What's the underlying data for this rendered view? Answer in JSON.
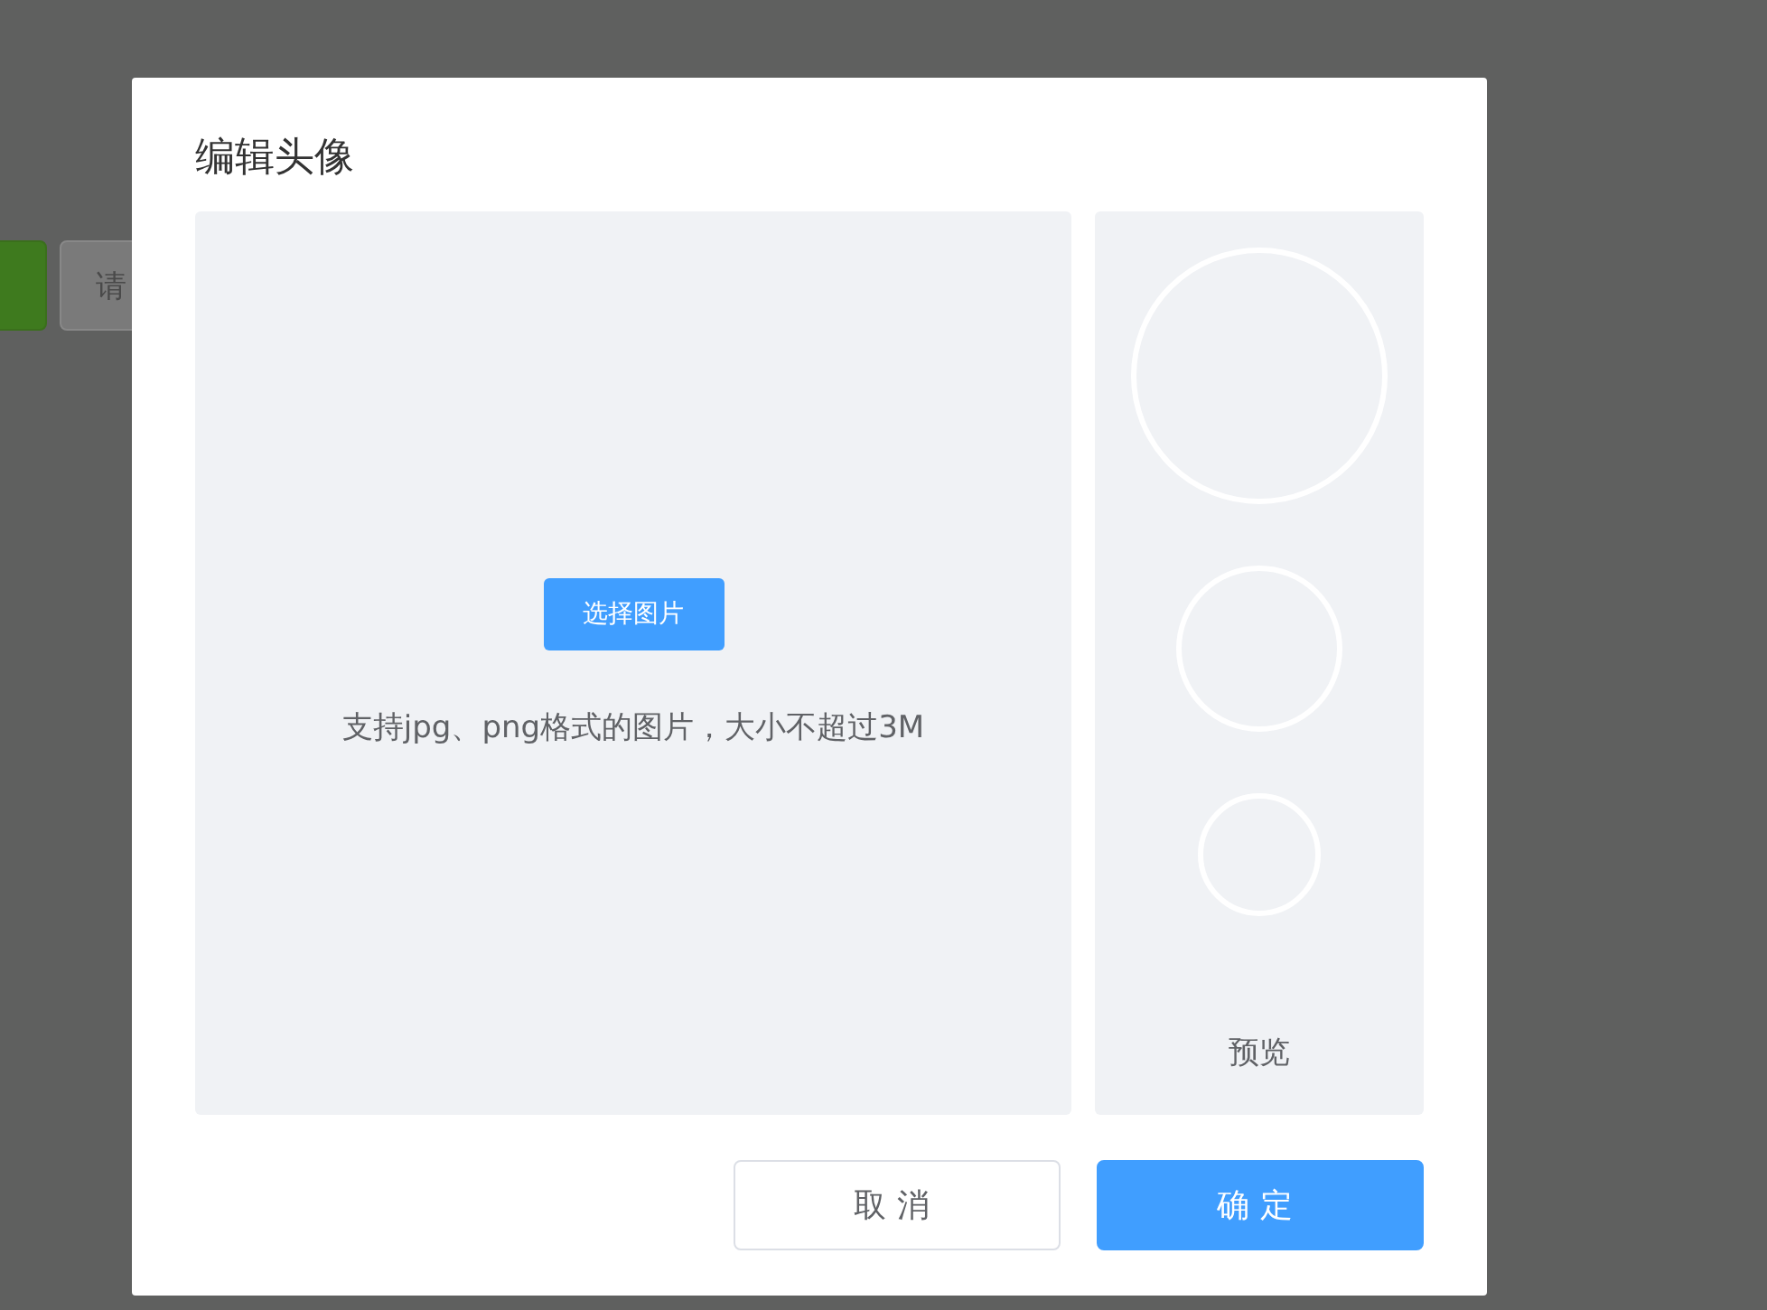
{
  "page": {
    "buttons": [
      {
        "kind": "primary"
      },
      {
        "kind": "default",
        "label": "请"
      }
    ]
  },
  "dialog": {
    "title": "编辑头像",
    "crop_area": {
      "button": "选择图片",
      "hint": "支持jpg、png格式的图片，大小不超过3M"
    },
    "preview": {
      "label": "预览"
    },
    "buttons": [
      {
        "kind": "default",
        "label": "取消"
      },
      {
        "kind": "primary",
        "label": "确定"
      }
    ]
  }
}
